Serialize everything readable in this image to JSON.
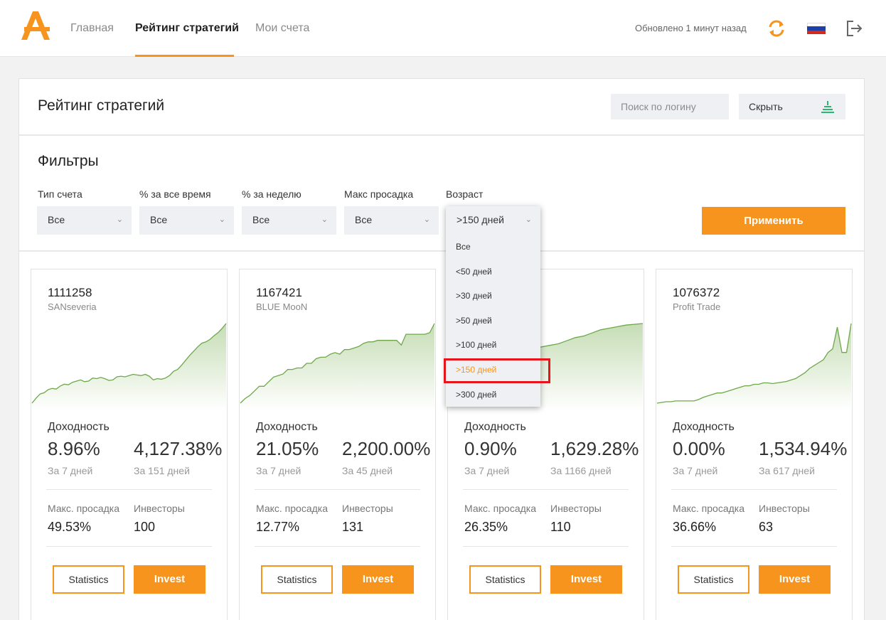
{
  "header": {
    "nav": [
      "Главная",
      "Рейтинг стратегий",
      "Мои счета"
    ],
    "updated": "Обновлено 1 минут назад",
    "accent_color": "#f7941d"
  },
  "panel": {
    "title": "Рейтинг стратегий",
    "search_placeholder": "Поиск по логину",
    "hide_label": "Скрыть"
  },
  "filters": {
    "title": "Фильтры",
    "items": [
      {
        "label": "Тип счета",
        "value": "Все"
      },
      {
        "label": "% за все время",
        "value": "Все"
      },
      {
        "label": "% за неделю",
        "value": "Все"
      },
      {
        "label": "Макс просадка",
        "value": "Все"
      },
      {
        "label": "Возраст",
        "value": ">150 дней"
      }
    ],
    "apply": "Применить",
    "age_options": [
      "Все",
      "<50 дней",
      ">30 дней",
      ">50 дней",
      ">100 дней",
      ">150 дней",
      ">300 дней"
    ],
    "age_selected": ">150 дней"
  },
  "cards_common": {
    "yield_label": "Доходность",
    "week_label": "За 7 дней",
    "drawdown_label": "Макс. просадка",
    "investors_label": "Инвесторы",
    "stats_button": "Statistics",
    "invest_button": "Invest"
  },
  "cards": [
    {
      "account": "1111258",
      "name": "SANseveria",
      "pct_week": "8.96%",
      "pct_total": "4,127.38%",
      "days": "За 151 дней",
      "drawdown": "49.53%",
      "investors": "100",
      "curve": [
        0,
        8,
        15,
        17,
        22,
        24,
        23,
        28,
        31,
        30,
        34,
        36,
        38,
        35,
        36,
        41,
        40,
        42,
        40,
        37,
        38,
        43,
        44,
        43,
        45,
        47,
        46,
        45,
        47,
        44,
        38,
        40,
        39,
        41,
        45,
        52,
        55,
        62,
        70,
        78,
        85,
        92,
        98,
        100,
        104,
        110,
        115,
        122,
        130
      ]
    },
    {
      "account": "1167421",
      "name": "BLUE MooN",
      "pct_week": "21.05%",
      "pct_total": "2,200.00%",
      "days": "За 45 дней",
      "drawdown": "12.77%",
      "investors": "131",
      "curve": [
        0,
        6,
        10,
        16,
        22,
        22,
        28,
        34,
        36,
        38,
        44,
        44,
        46,
        46,
        52,
        52,
        58,
        60,
        60,
        64,
        66,
        64,
        70,
        70,
        72,
        74,
        78,
        80,
        80,
        82,
        82,
        82,
        82,
        82,
        76,
        90,
        90,
        90,
        90,
        90,
        92,
        104
      ]
    },
    {
      "account": "",
      "name": "",
      "pct_week": "0.90%",
      "pct_total": "1,629.28%",
      "days": "За 1166 дней",
      "drawdown": "26.35%",
      "investors": "110",
      "curve": [
        40,
        44,
        48,
        50,
        54,
        56,
        58,
        60,
        64,
        66,
        70,
        72,
        74,
        76,
        80,
        84,
        86,
        90,
        94,
        96,
        98,
        100,
        101,
        102
      ]
    },
    {
      "account": "1076372",
      "name": "Profit Trade",
      "pct_week": "0.00%",
      "pct_total": "1,534.94%",
      "days": "За 617 дней",
      "drawdown": "36.66%",
      "investors": "63",
      "curve": [
        0,
        1,
        2,
        2,
        3,
        3,
        3,
        3,
        3,
        5,
        8,
        10,
        12,
        14,
        14,
        16,
        18,
        20,
        22,
        24,
        24,
        26,
        26,
        28,
        28,
        27,
        28,
        29,
        30,
        32,
        34,
        38,
        42,
        48,
        52,
        56,
        60,
        70,
        75,
        105,
        70,
        70,
        110
      ]
    }
  ]
}
